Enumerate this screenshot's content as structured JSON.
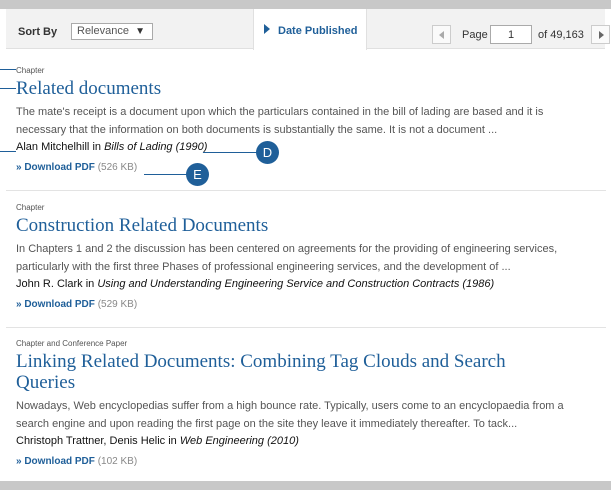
{
  "toolbar": {
    "sort_label": "Sort By",
    "sort_value": "Relevance",
    "date_tab": "Date Published",
    "page_label": "Page",
    "page_value": "1",
    "page_of": "of 49,163"
  },
  "results": [
    {
      "type": "Chapter",
      "title": "Related documents",
      "snippet_1": "The mate's receipt is a document upon which the particulars contained in the bill of lading are based and it is",
      "snippet_2": "necessary that the information on both documents is substantially the same. It is not a document ...",
      "author": "Alan Mitchelhill",
      "in": "in",
      "source": "Bills of Lading (1990)",
      "download_label": "» Download PDF",
      "download_size": "(526 KB)"
    },
    {
      "type": "Chapter",
      "title": "Construction Related Documents",
      "snippet_1": "In Chapters 1 and 2 the discussion has been centered on agreements for the providing of engineering services,",
      "snippet_2": "particularly with the first three Phases of professional engineering services, and the development of ...",
      "author": "John R. Clark",
      "in": "in",
      "source": "Using and Understanding Engineering Service and Construction Contracts (1986)",
      "download_label": "» Download PDF",
      "download_size": "(529 KB)"
    },
    {
      "type": "Chapter and Conference Paper",
      "title_1": "Linking Related Documents: Combining Tag Clouds and Search",
      "title_2": "Queries",
      "snippet_1": "Nowadays, Web encyclopedias suffer from a high bounce rate. Typically, users come to an encyclopaedia from a",
      "snippet_2": "search engine and upon reading the first page on the site they leave it immediately thereafter. To tack...",
      "author": "Christoph Trattner, Denis Helic",
      "in": "in",
      "source": "Web Engineering (2010)",
      "download_label": "» Download PDF",
      "download_size": "(102 KB)"
    }
  ],
  "callouts": {
    "d": "D",
    "e": "E"
  },
  "colors": {
    "accent": "#1f5f99",
    "band": "#c8c8c8",
    "toolbar": "#f2f2f2"
  }
}
